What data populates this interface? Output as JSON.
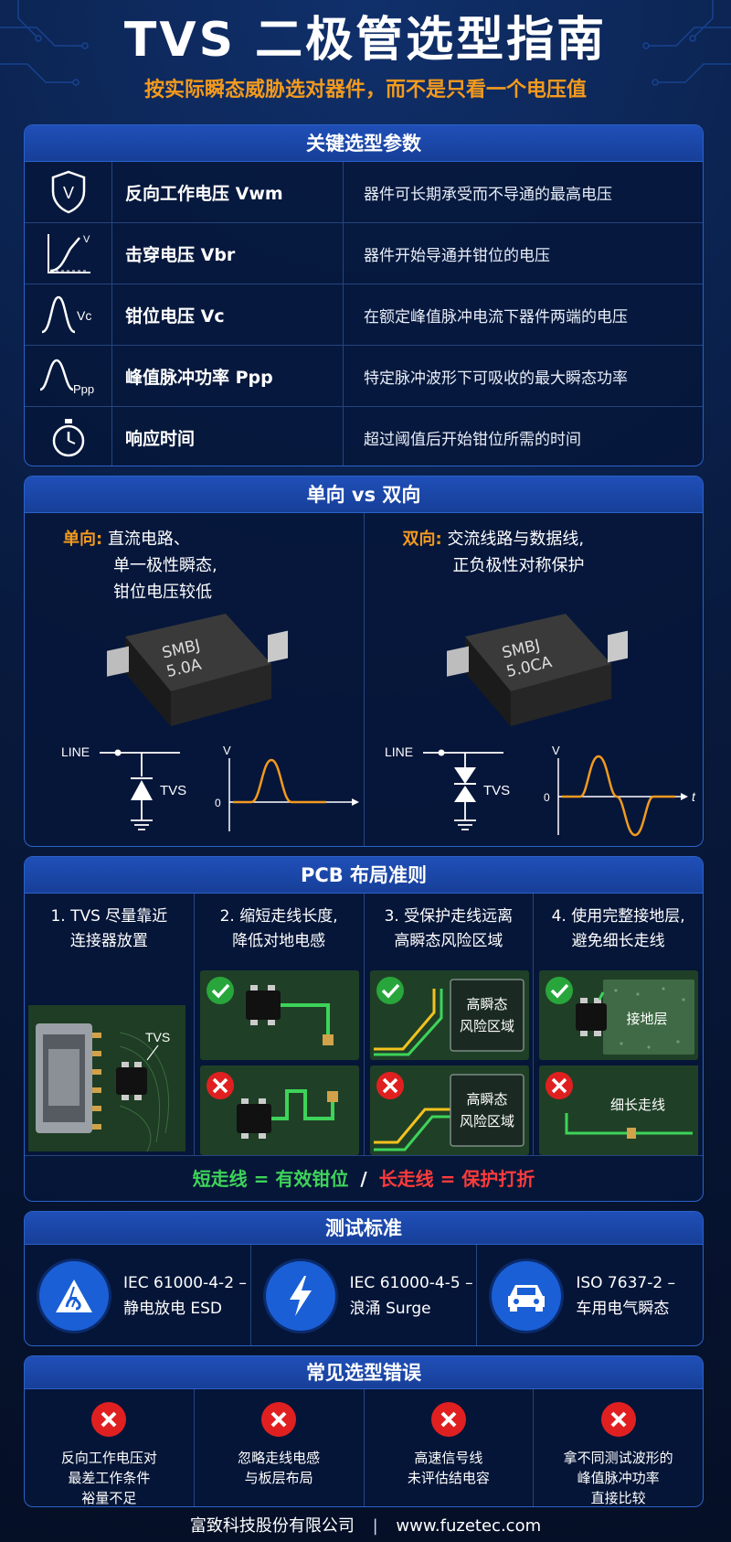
{
  "header": {
    "title": "TVS 二极管选型指南",
    "subtitle": "按实际瞬态威胁选对器件，而不是只看一个电压值"
  },
  "params": {
    "heading": "关键选型参数",
    "rows": [
      {
        "icon": "shield-v-icon",
        "name": "反向工作电压 Vwm",
        "desc": "器件可长期承受而不导通的最高电压"
      },
      {
        "icon": "breakdown-curve-icon",
        "name": "击穿电压 Vbr",
        "desc": "器件开始导通并钳位的电压"
      },
      {
        "icon": "clamp-pulse-icon",
        "name": "钳位电压 Vc",
        "desc": "在额定峰值脉冲电流下器件两端的电压"
      },
      {
        "icon": "peak-pulse-icon",
        "name": "峰值脉冲功率 Ppp",
        "desc": "特定脉冲波形下可吸收的最大瞬态功率"
      },
      {
        "icon": "stopwatch-icon",
        "name": "响应时间",
        "desc": "超过阈值后开始钳位所需的时间"
      }
    ],
    "icon_labels": {
      "v": "V",
      "vc": "Vc",
      "ppp": "Ppp"
    }
  },
  "direction": {
    "heading": "单向 vs 双向",
    "uni": {
      "tag": "单向:",
      "lines": [
        "直流电路、",
        "单一极性瞬态,",
        "钳位电压较低"
      ],
      "chip_line1": "SMBJ",
      "chip_line2": "5.0A"
    },
    "bi": {
      "tag": "双向:",
      "lines": [
        "交流线路与数据线,",
        "正负极性对称保护"
      ],
      "chip_line1": "SMBJ",
      "chip_line2": "5.0CA"
    },
    "line_label": "LINE",
    "tvs_label": "TVS",
    "axis_v": "V",
    "axis_t": "t",
    "axis_zero": "0"
  },
  "pcb": {
    "heading": "PCB 布局准则",
    "cols": [
      {
        "lines": [
          "1. TVS 尽量靠近",
          "连接器放置"
        ]
      },
      {
        "lines": [
          "2. 缩短走线长度,",
          "降低对地电感"
        ]
      },
      {
        "lines": [
          "3. 受保护走线远离",
          "高瞬态风险区域"
        ]
      },
      {
        "lines": [
          "4. 使用完整接地层,",
          "避免细长走线"
        ]
      }
    ],
    "tvs_label": "TVS",
    "risk_line1": "高瞬态",
    "risk_line2": "风险区域",
    "ground_label": "接地层",
    "thin_label": "细长走线",
    "footer_good": "短走线 = 有效钳位",
    "footer_sep": "/",
    "footer_bad": "长走线 = 保护打折",
    "colors": {
      "good": "#3ed35a",
      "bad": "#ff3b3b"
    }
  },
  "standards": {
    "heading": "测试标准",
    "items": [
      {
        "icon": "esd-warning-icon",
        "line1": "IEC 61000-4-2 –",
        "line2": "静电放电 ESD"
      },
      {
        "icon": "lightning-icon",
        "line1": "IEC 61000-4-5 –",
        "line2": "浪涌 Surge"
      },
      {
        "icon": "car-icon",
        "line1": "ISO 7637-2 –",
        "line2": "车用电气瞬态"
      }
    ]
  },
  "errors": {
    "heading": "常见选型错误",
    "items": [
      {
        "lines": [
          "反向工作电压对",
          "最差工作条件",
          "裕量不足"
        ]
      },
      {
        "lines": [
          "忽略走线电感",
          "与板层布局"
        ]
      },
      {
        "lines": [
          "高速信号线",
          "未评估结电容"
        ]
      },
      {
        "lines": [
          "拿不同测试波形的",
          "峰值脉冲功率",
          "直接比较"
        ]
      }
    ]
  },
  "footer": {
    "company": "富致科技股份有限公司",
    "bar": "|",
    "url": "www.fuzetec.com"
  },
  "theme": {
    "accent": "#f39a1e",
    "panel_border": "#2b62c9",
    "background": "#071635"
  }
}
